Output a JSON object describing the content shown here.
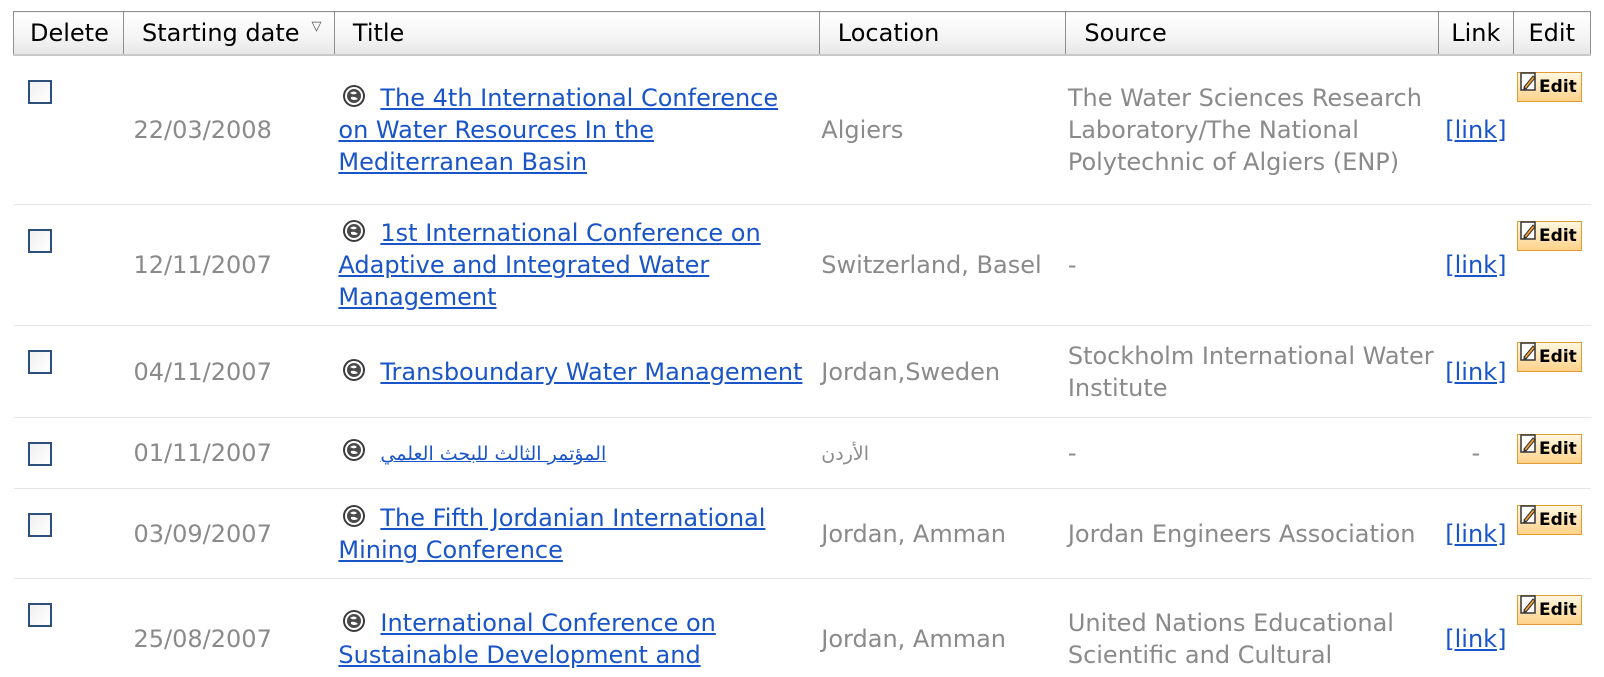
{
  "table": {
    "headers": {
      "delete": "Delete",
      "starting_date": "Starting date",
      "title": "Title",
      "location": "Location",
      "source": "Source",
      "link": "Link",
      "edit": "Edit"
    },
    "sort_indicator": "descending",
    "rows": [
      {
        "date": "22/03/2008",
        "title": "The 4th International Conference on Water Resources In the Mediterranean Basin",
        "location": "Algiers",
        "source": "The Water Sciences Research Laboratory/The National Polytechnic of Algiers (ENP)",
        "link": "[link]",
        "edit": "Edit"
      },
      {
        "date": "12/11/2007",
        "title": "1st International Conference on Adaptive and Integrated Water Management",
        "location": "Switzerland, Basel",
        "source": "-",
        "link": "[link]",
        "edit": "Edit"
      },
      {
        "date": "04/11/2007",
        "title": "Transboundary Water Management",
        "location": "Jordan,Sweden",
        "source": "Stockholm International Water Institute",
        "link": "[link]",
        "edit": "Edit"
      },
      {
        "date": "01/11/2007",
        "title": "المؤتمر الثالث للبحث العلمي",
        "location": "الأردن",
        "source": "-",
        "link": "-",
        "edit": "Edit"
      },
      {
        "date": "03/09/2007",
        "title": "The Fifth Jordanian International Mining Conference",
        "location": "Jordan, Amman",
        "source": "Jordan Engineers Association",
        "link": "[link]",
        "edit": "Edit"
      },
      {
        "date": "25/08/2007",
        "title": "International Conference on Sustainable Development and",
        "location": "Jordan, Amman",
        "source": "United Nations Educational Scientific and Cultural",
        "link": "[link]",
        "edit": "Edit"
      }
    ]
  },
  "colors": {
    "link": "#1a55c8",
    "muted_text": "#8a8a8a",
    "edit_button_fill": "#ffd28a",
    "edit_button_border": "#e09b34",
    "checkbox_border": "#2c4f7c"
  },
  "icons": {
    "title_icon": "globe-icon",
    "edit_icon": "pencil-edit-icon",
    "sort_icon": "sort-descending-icon"
  }
}
